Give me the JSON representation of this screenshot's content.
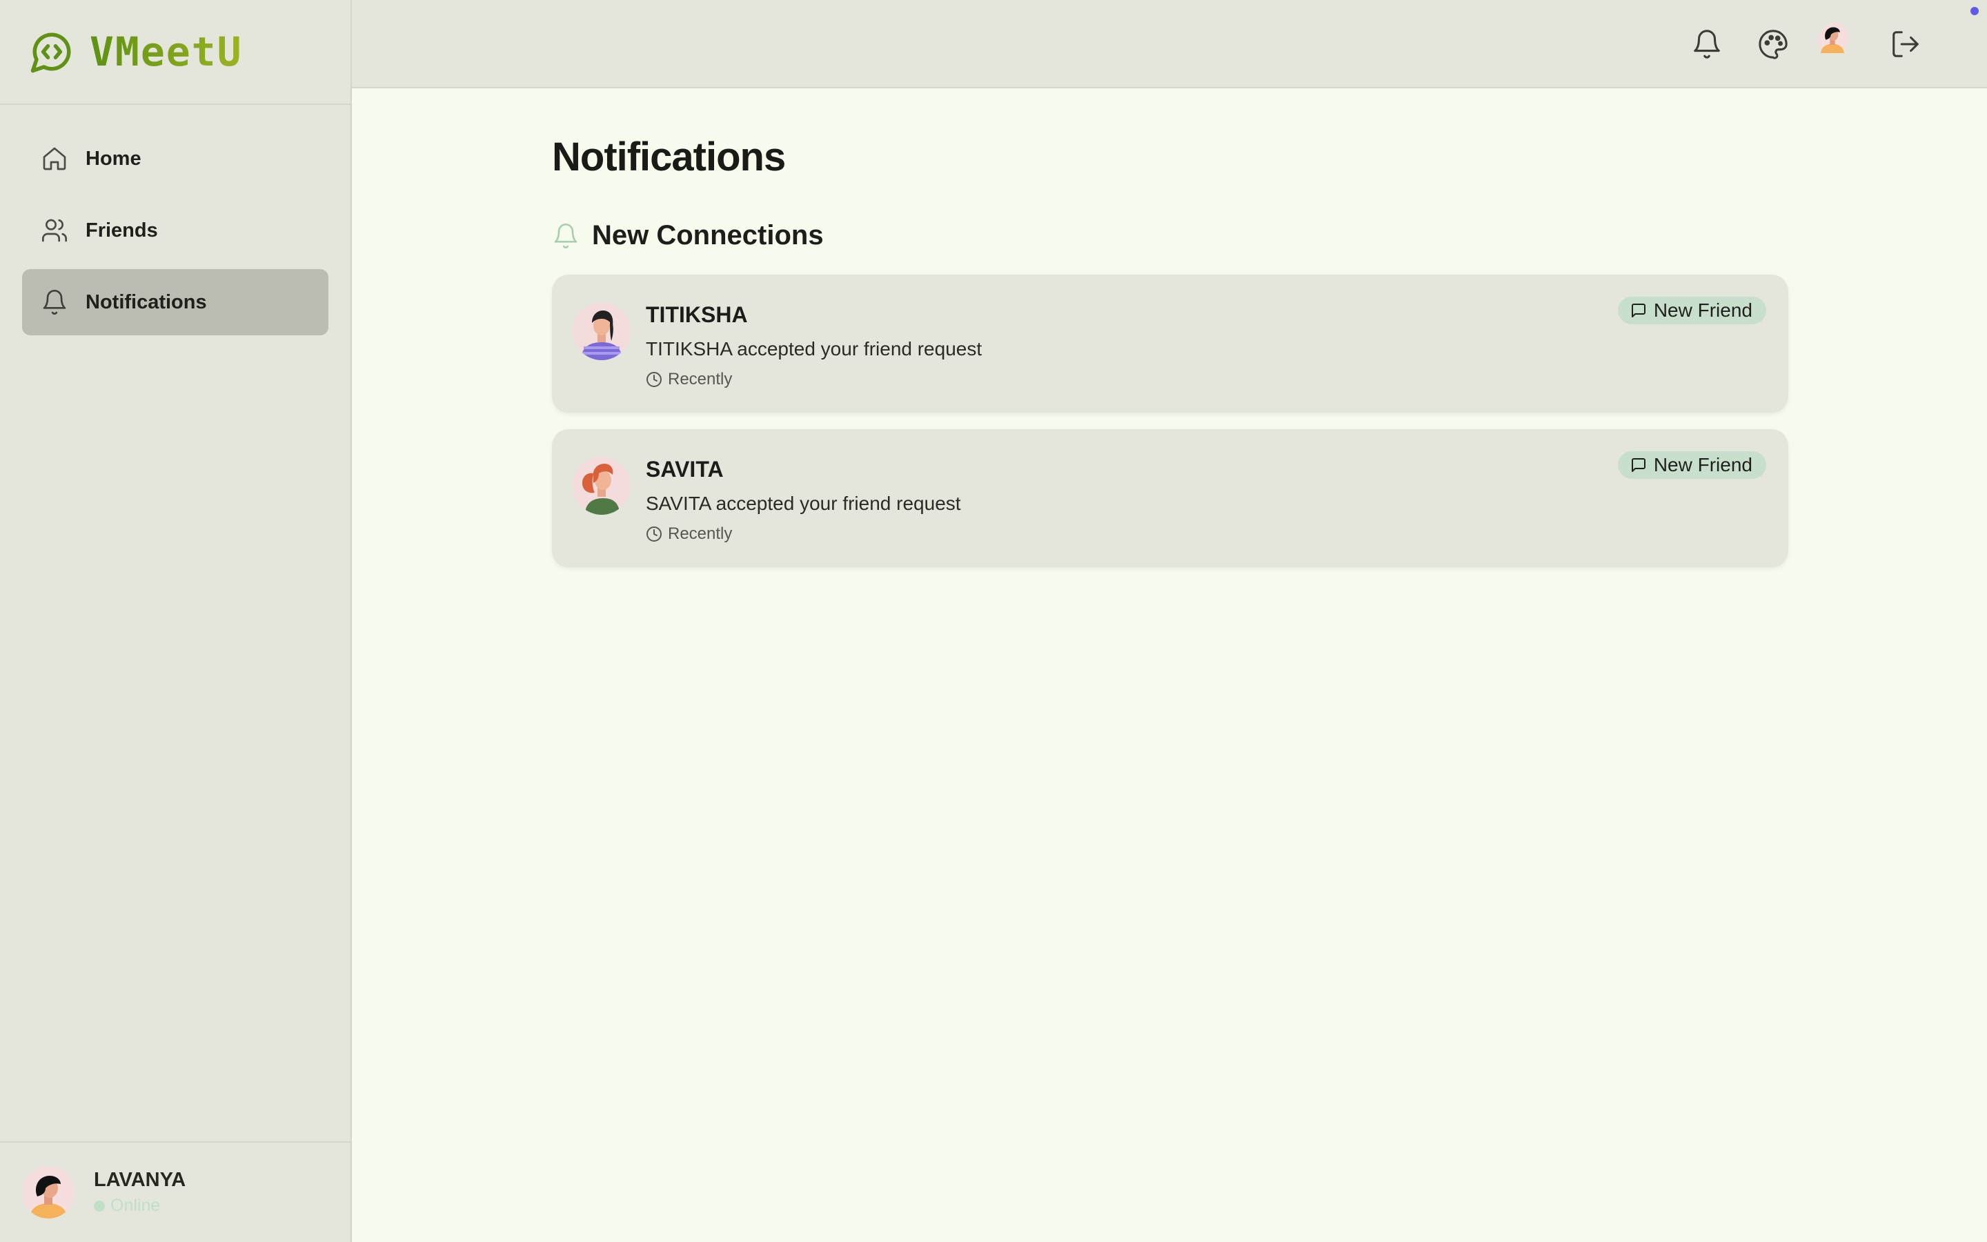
{
  "app": {
    "name": "VMeetU"
  },
  "sidebar": {
    "items": [
      {
        "label": "Home",
        "icon": "home-icon",
        "active": false
      },
      {
        "label": "Friends",
        "icon": "users-icon",
        "active": false
      },
      {
        "label": "Notifications",
        "icon": "bell-icon",
        "active": true
      }
    ],
    "user": {
      "name": "LAVANYA",
      "status": "Online"
    }
  },
  "topbar": {
    "icons": [
      "bell-icon",
      "palette-icon",
      "avatar",
      "logout-icon"
    ]
  },
  "main": {
    "title": "Notifications",
    "section_title": "New Connections",
    "notifications": [
      {
        "name": "TITIKSHA",
        "message": "TITIKSHA accepted your friend request",
        "time": "Recently",
        "badge": "New Friend"
      },
      {
        "name": "SAVITA",
        "message": "SAVITA accepted your friend request",
        "time": "Recently",
        "badge": "New Friend"
      }
    ]
  },
  "colors": {
    "brand_start": "#5e9114",
    "brand_end": "#9bb321",
    "accent_badge": "#c8dfcc",
    "online": "#bfe0c6"
  }
}
